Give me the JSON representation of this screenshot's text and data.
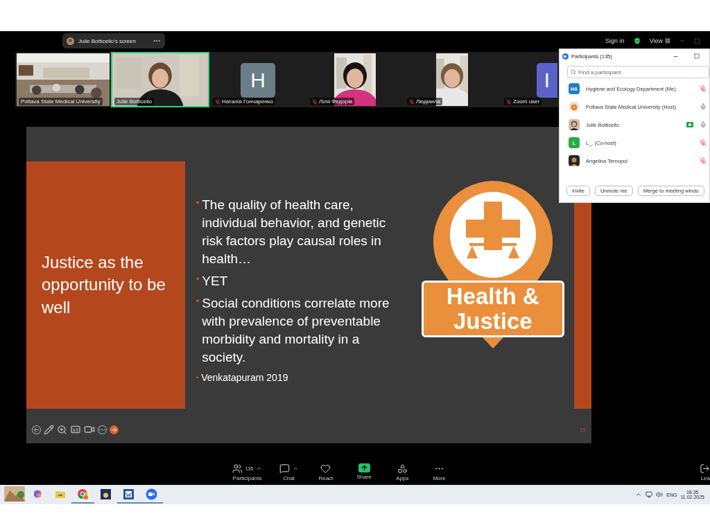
{
  "share_pill": {
    "label": "Julie Botticello's screen"
  },
  "top_bar": {
    "sign_in": "Sign in",
    "view": "View"
  },
  "video_tiles": [
    {
      "name": "Poltava State Medical University",
      "kind": "room_video",
      "muted": false,
      "speaking": false
    },
    {
      "name": "Julie Botticello",
      "kind": "video",
      "muted": false,
      "speaking": true
    },
    {
      "name": "Наталія Гончаренко",
      "kind": "avatar",
      "initial": "H",
      "color": "#6b7d86",
      "muted": true,
      "speaking": false
    },
    {
      "name": "Ліля Федорів",
      "kind": "portrait_video",
      "muted": true,
      "speaking": false
    },
    {
      "name": "Людмила",
      "kind": "portrait_video",
      "muted": true,
      "speaking": false
    },
    {
      "name": "Zoom user",
      "kind": "avatar",
      "initial": "I",
      "color": "#5b63c8",
      "muted": true,
      "speaking": false
    }
  ],
  "slide": {
    "title": "Justice as the opportunity to be well",
    "bullets": [
      {
        "kind": "bullet",
        "marker": "•",
        "text": "The quality of health care, individual behavior, and genetic risk factors play causal roles in health…"
      },
      {
        "kind": "bullet",
        "marker": "•",
        "text": "YET"
      },
      {
        "kind": "bullet",
        "marker": "•",
        "text": "Social conditions correlate more with prevalence of preventable morbidity and mortality in a society."
      },
      {
        "kind": "citation",
        "marker": "•",
        "text": "Venkatapuram 2019"
      }
    ],
    "logo": {
      "line_1": "Health &",
      "line_2": "Justice"
    },
    "page_number": "15"
  },
  "participants_panel": {
    "title": "Participants (135)",
    "search": {
      "placeholder": "Find a participant"
    },
    "participants": [
      {
        "name": "Hygiene and Ecology Department (Me)",
        "kind": "initials",
        "initials": "HA",
        "color": "#1f7fc4",
        "muted": true,
        "video": false
      },
      {
        "name": "Poltava State Medical University (Host)",
        "kind": "emblem",
        "muted": false,
        "video": false
      },
      {
        "name": "Julie Botticello",
        "muted": false,
        "video": true
      },
      {
        "name": "L_. (Co-host)",
        "kind": "initials",
        "initials": "L",
        "color": "#2aa84a",
        "muted": true,
        "video": false
      },
      {
        "name": "Angelina Ternopol",
        "kind": "photo_dark",
        "muted": true,
        "video": false
      }
    ],
    "buttons": [
      "Invite",
      "Unmute me",
      "Merge to meeting windo"
    ]
  },
  "toolbar": [
    {
      "kind": "participants",
      "label": "Participants",
      "count": "135",
      "caret": true
    },
    {
      "kind": "chat",
      "label": "Chat",
      "caret": true
    },
    {
      "kind": "react",
      "label": "React",
      "caret": false
    },
    {
      "kind": "share",
      "label": "Share",
      "caret": false
    },
    {
      "kind": "apps",
      "label": "Apps",
      "caret": false
    },
    {
      "kind": "more",
      "label": "More",
      "caret": false
    },
    {
      "kind": "leave",
      "label": "Lea",
      "caret": false
    }
  ],
  "taskbar": {
    "apps": [
      {
        "kind": "weather_picture",
        "running": false
      },
      {
        "kind": "copilot",
        "running": false
      },
      {
        "kind": "files",
        "running": false
      },
      {
        "kind": "chrome",
        "running": true
      },
      {
        "kind": "sun_app",
        "running": false
      },
      {
        "kind": "word",
        "running": true
      },
      {
        "kind": "zoom",
        "running": true
      }
    ],
    "language": "ENG",
    "time": "16:35",
    "date": "11.02.2025"
  }
}
